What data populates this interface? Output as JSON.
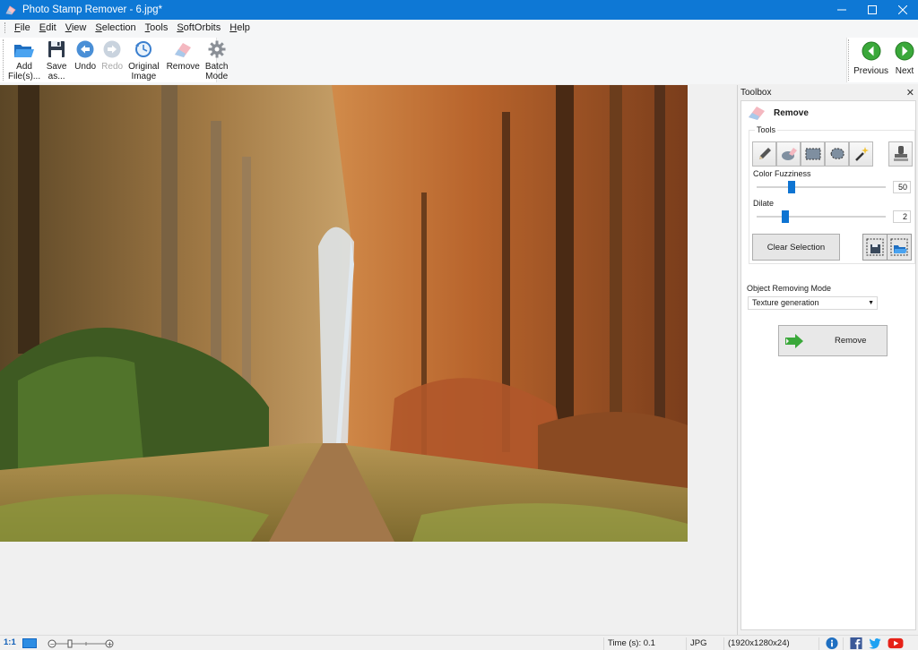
{
  "window": {
    "title": "Photo Stamp Remover - 6.jpg*",
    "buttons": [
      "minimize",
      "maximize",
      "close"
    ]
  },
  "menu": [
    "File",
    "Edit",
    "View",
    "Selection",
    "Tools",
    "SoftOrbits",
    "Help"
  ],
  "toolbar": {
    "add_files": "Add\nFile(s)...",
    "save_as": "Save\nas...",
    "undo": "Undo",
    "redo": "Redo",
    "original_image": "Original\nImage",
    "remove": "Remove",
    "batch_mode": "Batch\nMode",
    "previous": "Previous",
    "next": "Next"
  },
  "toolbox": {
    "header": "Toolbox",
    "section_title": "Remove",
    "tools_legend": "Tools",
    "tool_icons": [
      "pencil-icon",
      "eraser-icon",
      "rect-select-icon",
      "lasso-icon",
      "magic-wand-icon",
      "stamp-icon"
    ],
    "color_fuzziness": {
      "label": "Color Fuzziness",
      "value": "50",
      "fraction": 0.27
    },
    "dilate": {
      "label": "Dilate",
      "value": "2",
      "fraction": 0.22
    },
    "clear_selection": "Clear Selection",
    "mode_label": "Object Removing Mode",
    "mode_value": "Texture generation",
    "remove_button": "Remove"
  },
  "status": {
    "zoom_1_1": "1:1",
    "time": "Time (s): 0.1",
    "format": "JPG",
    "dimensions": "(1920x1280x24)"
  },
  "colors": {
    "titlebar": "#0e78d5",
    "accent_green": "#3aa83a",
    "slider_thumb": "#0e74d2"
  }
}
